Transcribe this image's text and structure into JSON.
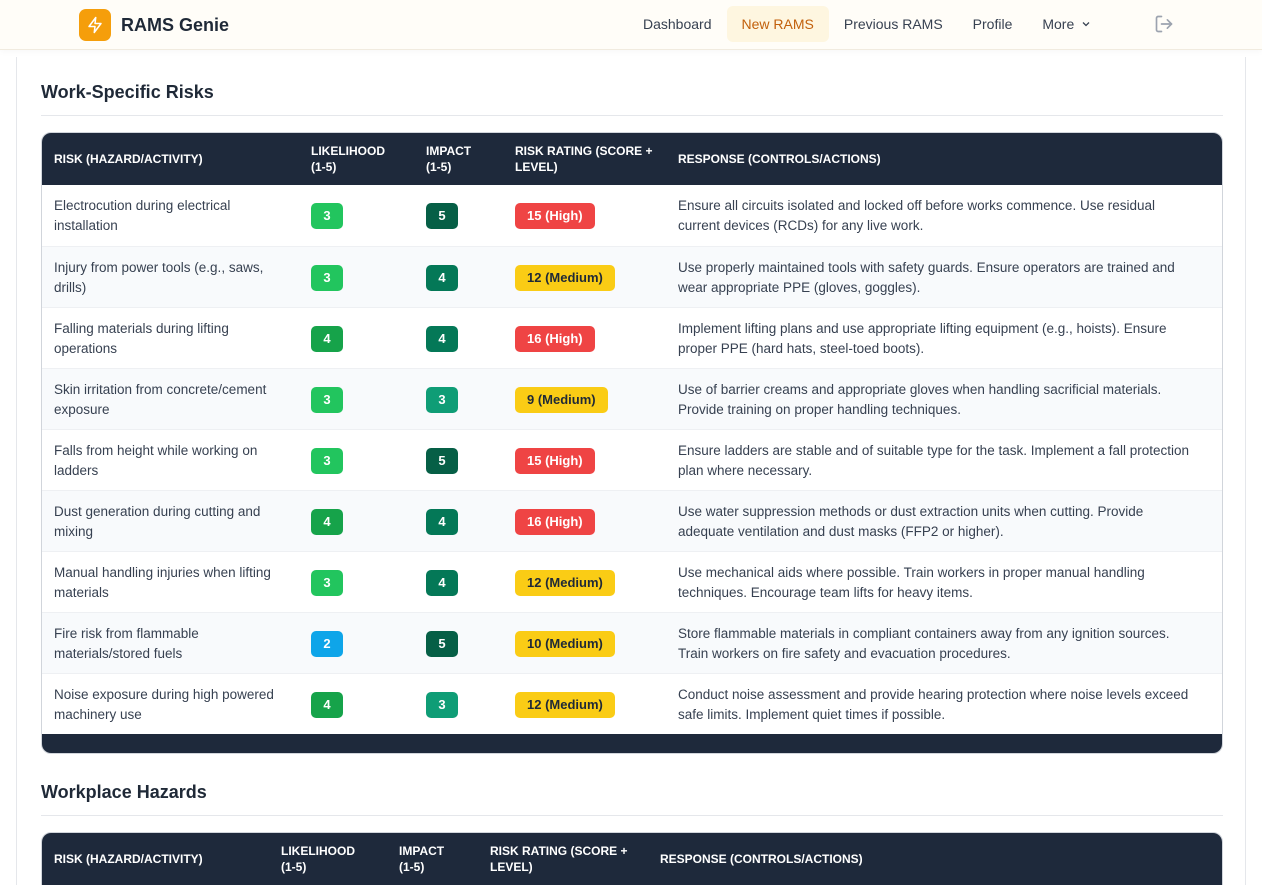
{
  "app": {
    "name": "RAMS Genie",
    "brand_icon": "lightning-icon"
  },
  "nav": {
    "items": [
      {
        "label": "Dashboard",
        "active": false
      },
      {
        "label": "New RAMS",
        "active": true
      },
      {
        "label": "Previous RAMS",
        "active": false
      },
      {
        "label": "Profile",
        "active": false
      },
      {
        "label": "More",
        "active": false
      }
    ],
    "logout_icon": "logout-icon"
  },
  "colors": {
    "accent": "#f59e0b",
    "header_dark": "#1e293b",
    "likelihood": {
      "2": "#0ea5e9",
      "3": "#22c55e",
      "4": "#16a34a"
    },
    "impact": {
      "3": "#0f9d76",
      "4": "#047857",
      "5": "#065f46"
    },
    "high": "#ef4444",
    "medium": "#facc15"
  },
  "work_specific": {
    "title": "Work-Specific Risks",
    "headers": {
      "risk": "Risk (Hazard/Activity)",
      "likelihood_1": "Likelihood",
      "likelihood_2": "(1-5)",
      "impact_1": "Impact",
      "impact_2": "(1-5)",
      "rating_1": "Risk Rating (Score +",
      "rating_2": "Level)",
      "response": "Response (Controls/Actions)"
    },
    "rows": [
      {
        "risk_1": "Electrocution during electrical",
        "risk_2": "installation",
        "likelihood": "3",
        "impact": "5",
        "rating": "15 (High)",
        "level": "high",
        "response_1": "Ensure all circuits isolated and locked off before works commence. Use residual",
        "response_2": "current devices (RCDs) for any live work."
      },
      {
        "risk_1": "Injury from power tools (e.g., saws,",
        "risk_2": "drills)",
        "likelihood": "3",
        "impact": "4",
        "rating": "12 (Medium)",
        "level": "medium",
        "response_1": "Use properly maintained tools with safety guards. Ensure operators are trained and",
        "response_2": "wear appropriate PPE (gloves, goggles)."
      },
      {
        "risk_1": "Falling materials during lifting",
        "risk_2": "operations",
        "likelihood": "4",
        "impact": "4",
        "rating": "16 (High)",
        "level": "high",
        "response_1": "Implement lifting plans and use appropriate lifting equipment (e.g., hoists). Ensure",
        "response_2": "proper PPE (hard hats, steel-toed boots)."
      },
      {
        "risk_1": "Skin irritation from concrete/cement",
        "risk_2": "exposure",
        "likelihood": "3",
        "impact": "3",
        "rating": "9 (Medium)",
        "level": "medium",
        "response_1": "Use of barrier creams and appropriate gloves when handling sacrificial materials.",
        "response_2": "Provide training on proper handling techniques."
      },
      {
        "risk_1": "Falls from height while working on",
        "risk_2": "ladders",
        "likelihood": "3",
        "impact": "5",
        "rating": "15 (High)",
        "level": "high",
        "response_1": "Ensure ladders are stable and of suitable type for the task. Implement a fall protection",
        "response_2": "plan where necessary."
      },
      {
        "risk_1": "Dust generation during cutting and",
        "risk_2": "mixing",
        "likelihood": "4",
        "impact": "4",
        "rating": "16 (High)",
        "level": "high",
        "response_1": "Use water suppression methods or dust extraction units when cutting. Provide",
        "response_2": "adequate ventilation and dust masks (FFP2 or higher)."
      },
      {
        "risk_1": "Manual handling injuries when lifting",
        "risk_2": "materials",
        "likelihood": "3",
        "impact": "4",
        "rating": "12 (Medium)",
        "level": "medium",
        "response_1": "Use mechanical aids where possible. Train workers in proper manual handling",
        "response_2": "techniques. Encourage team lifts for heavy items."
      },
      {
        "risk_1": "Fire risk from flammable",
        "risk_2": "materials/stored fuels",
        "likelihood": "2",
        "impact": "5",
        "rating": "10 (Medium)",
        "level": "medium",
        "response_1": "Store flammable materials in compliant containers away from any ignition sources.",
        "response_2": "Train workers on fire safety and evacuation procedures."
      },
      {
        "risk_1": "Noise exposure during high powered",
        "risk_2": "machinery use",
        "likelihood": "4",
        "impact": "3",
        "rating": "12 (Medium)",
        "level": "medium",
        "response_1": "Conduct noise assessment and provide hearing protection where noise levels exceed",
        "response_2": "safe limits. Implement quiet times if possible."
      }
    ]
  },
  "workplace": {
    "title": "Workplace Hazards",
    "headers": {
      "risk": "Risk (Hazard/Activity)",
      "likelihood_1": "Likelihood",
      "likelihood_2": "(1-5)",
      "impact_1": "Impact",
      "impact_2": "(1-5)",
      "rating_1": "Risk Rating (Score +",
      "rating_2": "Level)",
      "response": "Response (Controls/Actions)"
    }
  }
}
